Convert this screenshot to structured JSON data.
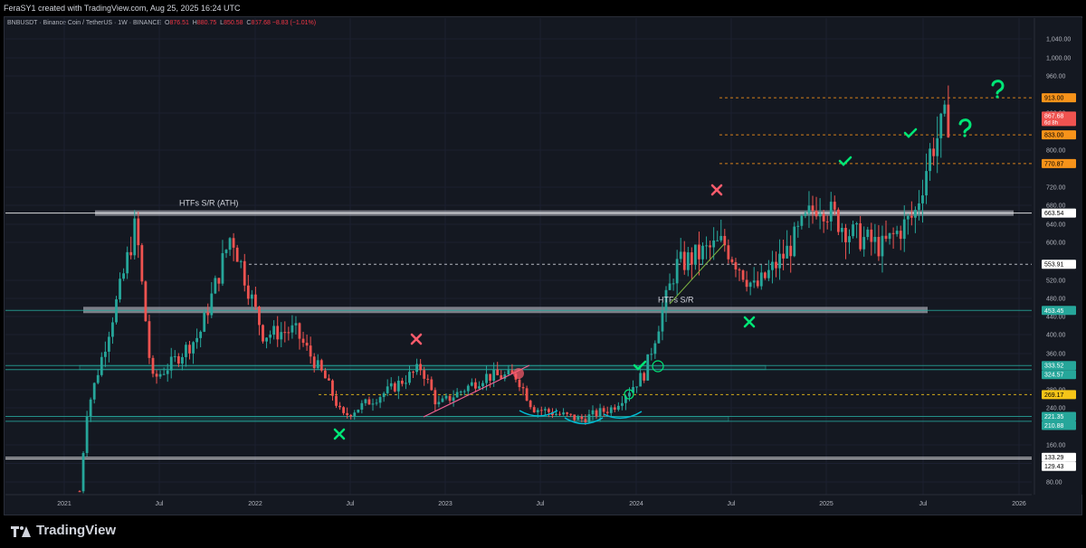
{
  "header": {
    "caption": "FeraSY1 created with TradingView.com, Aug 25, 2025 16:24 UTC"
  },
  "legend": {
    "symbol": "BNBUSDT · Binance Coin / TetherUS · 1W · BINANCE",
    "o_label": "O",
    "o": "876.51",
    "h_label": "H",
    "h": "880.75",
    "l_label": "L",
    "l": "850.58",
    "c_label": "C",
    "c": "867.68 −8.83 (−1.01%)"
  },
  "currency": "USDT",
  "brand": "TradingView",
  "colors": {
    "up": "#26a69a",
    "down": "#ef5350",
    "background": "#141821",
    "orange_level": "#f7931a",
    "green_mark": "#00e676",
    "red_mark": "#ff5c6c"
  },
  "chart_data": {
    "type": "candlestick",
    "timeframe": "1W",
    "x_ticks": [
      "2021",
      "Jul",
      "2022",
      "Jul",
      "2023",
      "Jul",
      "2024",
      "Jul",
      "2025",
      "Jul",
      "2026"
    ],
    "y_ticks": [
      "1,040.00",
      "1,000.00",
      "960.00",
      "880.00",
      "800.00",
      "720.00",
      "680.00",
      "640.00",
      "600.00",
      "520.00",
      "480.00",
      "440.00",
      "400.00",
      "360.00",
      "280.00",
      "240.00",
      "160.00",
      "120.00",
      "80.00"
    ],
    "ylim": [
      60,
      1080
    ],
    "current_price": {
      "value": "867.68",
      "countdown": "6d 8h"
    },
    "levels": [
      {
        "label": "913.00",
        "style": "dashed-orange"
      },
      {
        "label": "833.00",
        "style": "dashed-orange"
      },
      {
        "label": "770.87",
        "style": "dashed-orange"
      },
      {
        "label": "663.54",
        "style": "solid-white"
      },
      {
        "label": "553.91",
        "style": "dashed-white"
      },
      {
        "label": "453.45",
        "style": "zone"
      },
      {
        "label": "333.52",
        "style": "zone"
      },
      {
        "label": "324.57",
        "style": "zone"
      },
      {
        "label": "269.17",
        "style": "dashed-yellow"
      },
      {
        "label": "221.35",
        "style": "zone"
      },
      {
        "label": "210.88",
        "style": "zone"
      },
      {
        "label": "133.29",
        "style": "solid-white"
      },
      {
        "label": "129.43",
        "style": "solid-white"
      }
    ],
    "annotations": [
      {
        "text": "HTFs S/R (ATH)"
      },
      {
        "text": "HTFs S/R"
      }
    ],
    "weekly_close_keypoints": [
      {
        "date": "2021-02",
        "close": 60
      },
      {
        "date": "2021-02",
        "close": 230
      },
      {
        "date": "2021-04",
        "close": 500
      },
      {
        "date": "2021-05",
        "close": 640
      },
      {
        "date": "2021-06",
        "close": 300
      },
      {
        "date": "2021-07",
        "close": 330
      },
      {
        "date": "2021-09",
        "close": 400
      },
      {
        "date": "2021-11",
        "close": 620
      },
      {
        "date": "2022-01",
        "close": 400
      },
      {
        "date": "2022-03",
        "close": 410
      },
      {
        "date": "2022-05",
        "close": 300
      },
      {
        "date": "2022-06",
        "close": 220
      },
      {
        "date": "2022-09",
        "close": 280
      },
      {
        "date": "2022-11",
        "close": 330
      },
      {
        "date": "2022-12",
        "close": 245
      },
      {
        "date": "2023-03",
        "close": 310
      },
      {
        "date": "2023-05",
        "close": 310
      },
      {
        "date": "2023-06",
        "close": 240
      },
      {
        "date": "2023-09",
        "close": 215
      },
      {
        "date": "2023-11",
        "close": 240
      },
      {
        "date": "2024-01",
        "close": 315
      },
      {
        "date": "2024-03",
        "close": 550
      },
      {
        "date": "2024-06",
        "close": 600
      },
      {
        "date": "2024-08",
        "close": 500
      },
      {
        "date": "2024-10",
        "close": 580
      },
      {
        "date": "2024-12",
        "close": 690
      },
      {
        "date": "2025-02",
        "close": 620
      },
      {
        "date": "2025-04",
        "close": 590
      },
      {
        "date": "2025-06",
        "close": 660
      },
      {
        "date": "2025-07",
        "close": 800
      },
      {
        "date": "2025-08",
        "close": 868
      }
    ]
  }
}
